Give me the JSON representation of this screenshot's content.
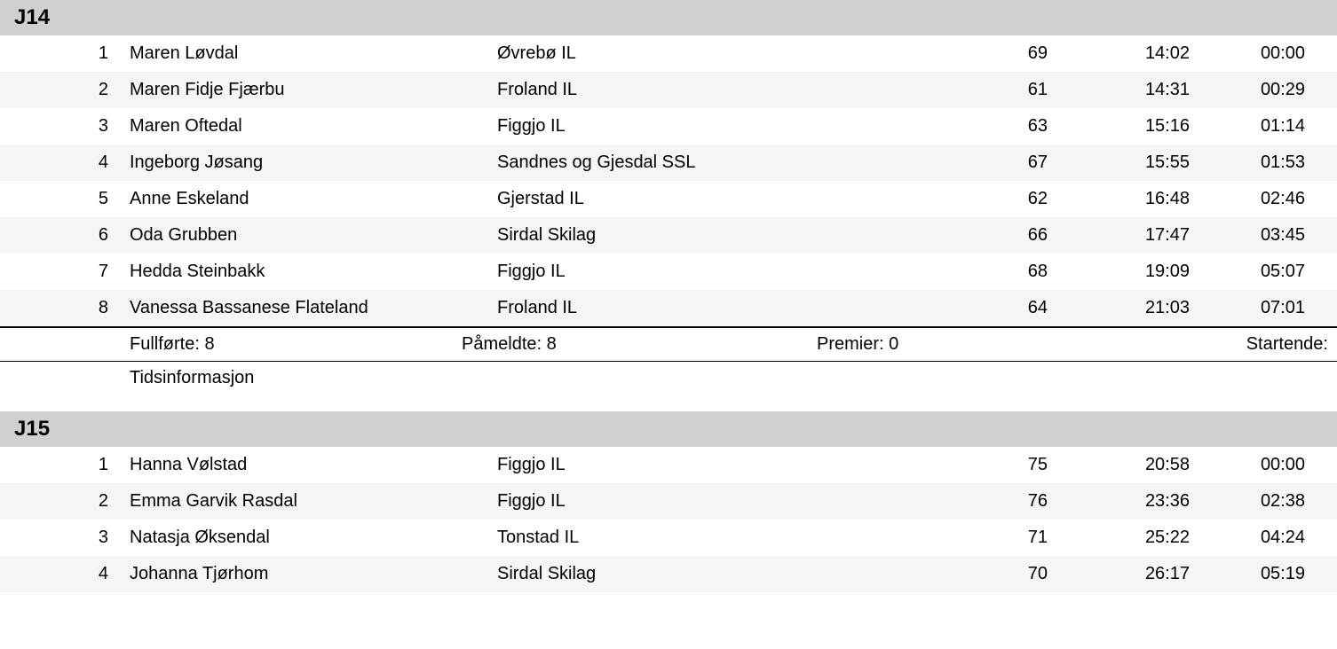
{
  "groups": [
    {
      "title": "J14",
      "rows": [
        {
          "place": "1",
          "name": "Maren Løvdal",
          "club": "Øvrebø IL",
          "bib": "69",
          "time": "14:02",
          "diff": "00:00"
        },
        {
          "place": "2",
          "name": "Maren Fidje Fjærbu",
          "club": "Froland IL",
          "bib": "61",
          "time": "14:31",
          "diff": "00:29"
        },
        {
          "place": "3",
          "name": "Maren Oftedal",
          "club": "Figgjo IL",
          "bib": "63",
          "time": "15:16",
          "diff": "01:14"
        },
        {
          "place": "4",
          "name": "Ingeborg Jøsang",
          "club": "Sandnes og Gjesdal SSL",
          "bib": "67",
          "time": "15:55",
          "diff": "01:53"
        },
        {
          "place": "5",
          "name": "Anne Eskeland",
          "club": "Gjerstad IL",
          "bib": "62",
          "time": "16:48",
          "diff": "02:46"
        },
        {
          "place": "6",
          "name": "Oda Grubben",
          "club": "Sirdal Skilag",
          "bib": "66",
          "time": "17:47",
          "diff": "03:45"
        },
        {
          "place": "7",
          "name": "Hedda Steinbakk",
          "club": "Figgjo IL",
          "bib": "68",
          "time": "19:09",
          "diff": "05:07"
        },
        {
          "place": "8",
          "name": "Vanessa Bassanese Flateland",
          "club": "Froland IL",
          "bib": "64",
          "time": "21:03",
          "diff": "07:01"
        }
      ],
      "summary": {
        "fullforte": "Fullførte: 8",
        "pameldte": "Påmeldte: 8",
        "premier": "Premier: 0",
        "startende": "Startende:"
      },
      "info": "Tidsinformasjon"
    },
    {
      "title": "J15",
      "rows": [
        {
          "place": "1",
          "name": "Hanna Vølstad",
          "club": "Figgjo IL",
          "bib": "75",
          "time": "20:58",
          "diff": "00:00"
        },
        {
          "place": "2",
          "name": "Emma Garvik Rasdal",
          "club": "Figgjo IL",
          "bib": "76",
          "time": "23:36",
          "diff": "02:38"
        },
        {
          "place": "3",
          "name": "Natasja Øksendal",
          "club": "Tonstad IL",
          "bib": "71",
          "time": "25:22",
          "diff": "04:24"
        },
        {
          "place": "4",
          "name": "Johanna Tjørhom",
          "club": "Sirdal Skilag",
          "bib": "70",
          "time": "26:17",
          "diff": "05:19"
        }
      ]
    }
  ]
}
